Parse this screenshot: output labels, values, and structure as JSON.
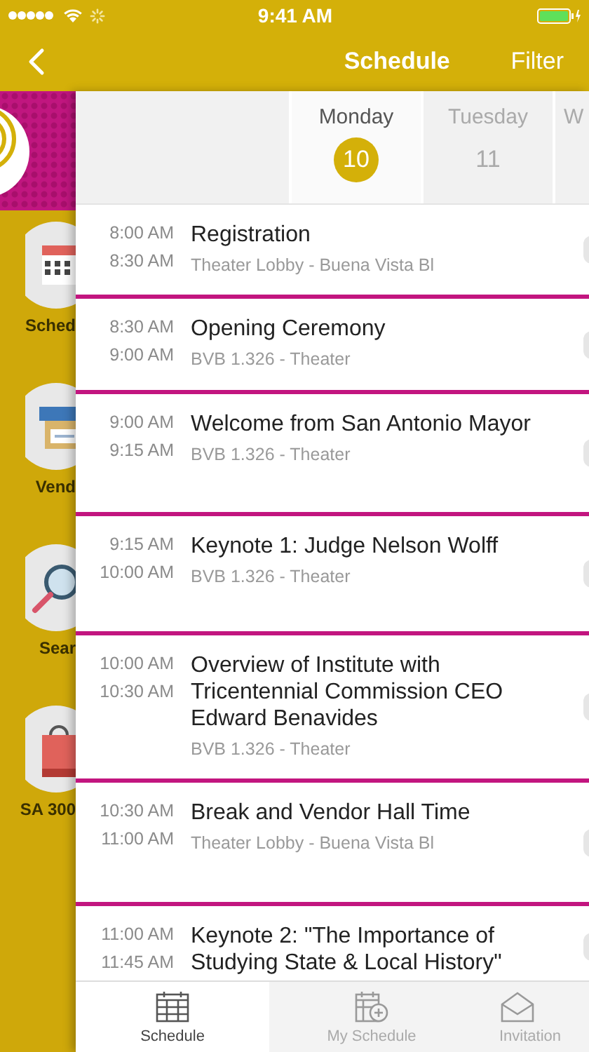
{
  "status_bar": {
    "time": "9:41 AM"
  },
  "nav": {
    "title": "Schedule",
    "action": "Filter"
  },
  "sidebar": {
    "items": [
      {
        "kind": "calendar",
        "label": "Sched"
      },
      {
        "kind": "store",
        "label": "Vend"
      },
      {
        "kind": "search",
        "label": "Sear"
      },
      {
        "kind": "bag",
        "label": "SA 300"
      }
    ]
  },
  "days": [
    {
      "name": "Monday",
      "date": "10",
      "selected": true
    },
    {
      "name": "Tuesday",
      "date": "11",
      "selected": false
    },
    {
      "name": "W",
      "selected": false
    }
  ],
  "sessions": [
    {
      "start": "8:00 AM",
      "end": "8:30 AM",
      "title": "Registration",
      "location": "Theater Lobby - Buena Vista Bl"
    },
    {
      "start": "8:30 AM",
      "end": "9:00 AM",
      "title": "Opening Ceremony",
      "location": "BVB 1.326 - Theater"
    },
    {
      "start": "9:00 AM",
      "end": "9:15 AM",
      "title": "Welcome from San Antonio Mayor",
      "location": "BVB 1.326 - Theater"
    },
    {
      "start": "9:15 AM",
      "end": "10:00 AM",
      "title": "Keynote 1: Judge Nelson Wolff",
      "location": "BVB 1.326 - Theater"
    },
    {
      "start": "10:00 AM",
      "end": "10:30 AM",
      "title": "Overview of Institute with Tricentennial Commission CEO Edward Benavides",
      "location": "BVB 1.326 - Theater"
    },
    {
      "start": "10:30 AM",
      "end": "11:00 AM",
      "title": "Break and Vendor Hall Time",
      "location": "Theater Lobby - Buena Vista Bl"
    },
    {
      "start": "11:00 AM",
      "end": "11:45 AM",
      "title": "Keynote 2: \"The Importance of Studying State & Local History\""
    }
  ],
  "tab_bar": [
    {
      "kind": "calendar",
      "label": "Schedule",
      "selected": true
    },
    {
      "kind": "calendar-add",
      "label": "My Schedule",
      "selected": false
    },
    {
      "kind": "envelope",
      "label": "Invitation",
      "selected": false
    }
  ]
}
